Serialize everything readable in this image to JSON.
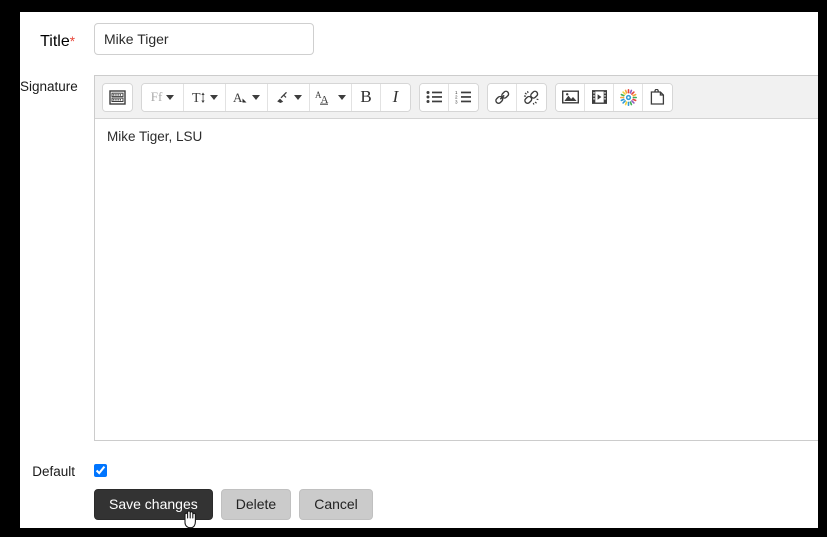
{
  "form": {
    "title_field": {
      "label": "Title",
      "required_marker": "*",
      "value": "Mike Tiger",
      "placeholder": ""
    },
    "signature_field": {
      "label": "Signature",
      "content": "Mike Tiger, LSU"
    },
    "default_field": {
      "label": "Default",
      "checked": true
    }
  },
  "toolbar": {
    "groups": [
      {
        "name": "insert-group",
        "buttons": [
          {
            "name": "special-character-button",
            "icon": "keyboard-icon",
            "label": "",
            "has_caret": false
          }
        ]
      },
      {
        "name": "format-group",
        "buttons": [
          {
            "name": "font-family-button",
            "icon": "font-family-icon",
            "label": "Ff",
            "has_caret": true
          },
          {
            "name": "font-size-button",
            "icon": "font-size-icon",
            "label": "T",
            "has_caret": true
          },
          {
            "name": "text-color-button",
            "icon": "text-color-icon",
            "label": "",
            "has_caret": true
          },
          {
            "name": "highlight-color-button",
            "icon": "highlighter-icon",
            "label": "",
            "has_caret": true
          },
          {
            "name": "text-style-button",
            "icon": "text-style-icon",
            "label": "",
            "has_caret": true
          },
          {
            "name": "bold-button",
            "icon": "bold-icon",
            "label": "B",
            "has_caret": false
          },
          {
            "name": "italic-button",
            "icon": "italic-icon",
            "label": "I",
            "has_caret": false
          }
        ]
      },
      {
        "name": "list-group",
        "buttons": [
          {
            "name": "bulleted-list-button",
            "icon": "bulleted-list-icon",
            "label": "",
            "has_caret": false
          },
          {
            "name": "numbered-list-button",
            "icon": "numbered-list-icon",
            "label": "",
            "has_caret": false
          }
        ]
      },
      {
        "name": "link-group",
        "buttons": [
          {
            "name": "insert-link-button",
            "icon": "link-icon",
            "label": "",
            "has_caret": false
          },
          {
            "name": "remove-link-button",
            "icon": "unlink-icon",
            "label": "",
            "has_caret": false
          }
        ]
      },
      {
        "name": "media-group",
        "buttons": [
          {
            "name": "insert-image-button",
            "icon": "image-icon",
            "label": "",
            "has_caret": false
          },
          {
            "name": "insert-video-button",
            "icon": "film-icon",
            "label": "",
            "has_caret": false
          },
          {
            "name": "insert-emoji-button",
            "icon": "starburst-icon",
            "label": "",
            "has_caret": false
          },
          {
            "name": "paste-button",
            "icon": "clipboard-icon",
            "label": "",
            "has_caret": false
          }
        ]
      }
    ]
  },
  "actions": {
    "save_label": "Save changes",
    "delete_label": "Delete",
    "cancel_label": "Cancel"
  },
  "colors": {
    "required_marker": "#e8463a",
    "primary_button_bg": "#333333",
    "secondary_button_bg": "#cbcbcb",
    "toolbar_bg": "#f1f1f1",
    "page_bg": "#ffffff",
    "frame": "#000000"
  }
}
